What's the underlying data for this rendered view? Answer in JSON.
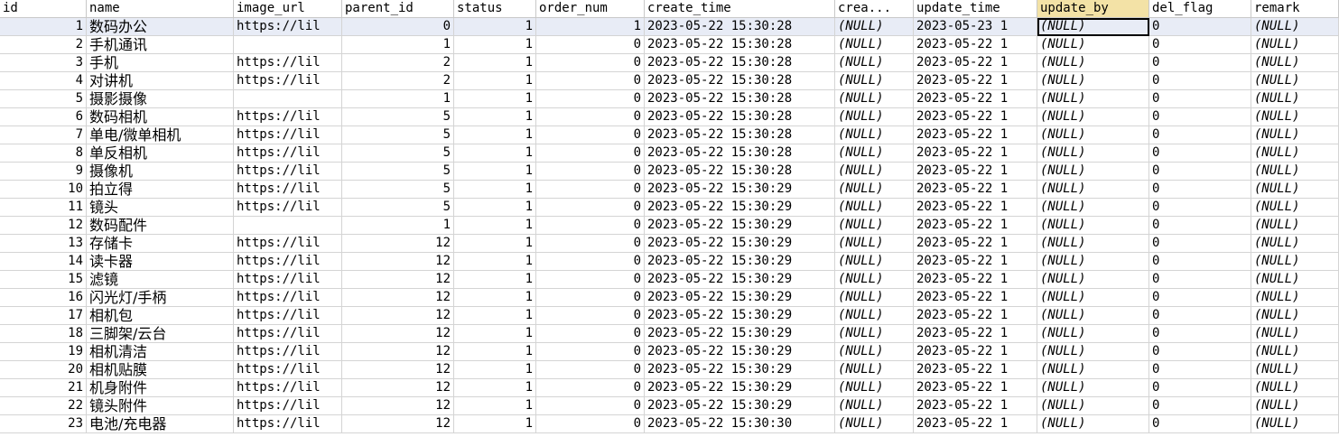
{
  "columns": [
    "id",
    "name",
    "image_url",
    "parent_id",
    "status",
    "order_num",
    "create_time",
    "crea...",
    "update_time",
    "update_by",
    "del_flag",
    "remark"
  ],
  "rows": [
    {
      "id": "1",
      "name": "数码办公",
      "image_url": "https://lil",
      "parent_id": "0",
      "status": "1",
      "order_num": "1",
      "create_time": "2023-05-22 15:30:28",
      "create_by": "(NULL)",
      "update_time": "2023-05-23 1",
      "update_by": "(NULL)",
      "del_flag": "0",
      "remark": "(NULL)"
    },
    {
      "id": "2",
      "name": "手机通讯",
      "image_url": "",
      "parent_id": "1",
      "status": "1",
      "order_num": "0",
      "create_time": "2023-05-22 15:30:28",
      "create_by": "(NULL)",
      "update_time": "2023-05-22 1",
      "update_by": "(NULL)",
      "del_flag": "0",
      "remark": "(NULL)"
    },
    {
      "id": "3",
      "name": "手机",
      "image_url": "https://lil",
      "parent_id": "2",
      "status": "1",
      "order_num": "0",
      "create_time": "2023-05-22 15:30:28",
      "create_by": "(NULL)",
      "update_time": "2023-05-22 1",
      "update_by": "(NULL)",
      "del_flag": "0",
      "remark": "(NULL)"
    },
    {
      "id": "4",
      "name": "对讲机",
      "image_url": "https://lil",
      "parent_id": "2",
      "status": "1",
      "order_num": "0",
      "create_time": "2023-05-22 15:30:28",
      "create_by": "(NULL)",
      "update_time": "2023-05-22 1",
      "update_by": "(NULL)",
      "del_flag": "0",
      "remark": "(NULL)"
    },
    {
      "id": "5",
      "name": "摄影摄像",
      "image_url": "",
      "parent_id": "1",
      "status": "1",
      "order_num": "0",
      "create_time": "2023-05-22 15:30:28",
      "create_by": "(NULL)",
      "update_time": "2023-05-22 1",
      "update_by": "(NULL)",
      "del_flag": "0",
      "remark": "(NULL)"
    },
    {
      "id": "6",
      "name": "数码相机",
      "image_url": "https://lil",
      "parent_id": "5",
      "status": "1",
      "order_num": "0",
      "create_time": "2023-05-22 15:30:28",
      "create_by": "(NULL)",
      "update_time": "2023-05-22 1",
      "update_by": "(NULL)",
      "del_flag": "0",
      "remark": "(NULL)"
    },
    {
      "id": "7",
      "name": "单电/微单相机",
      "image_url": "https://lil",
      "parent_id": "5",
      "status": "1",
      "order_num": "0",
      "create_time": "2023-05-22 15:30:28",
      "create_by": "(NULL)",
      "update_time": "2023-05-22 1",
      "update_by": "(NULL)",
      "del_flag": "0",
      "remark": "(NULL)"
    },
    {
      "id": "8",
      "name": "单反相机",
      "image_url": "https://lil",
      "parent_id": "5",
      "status": "1",
      "order_num": "0",
      "create_time": "2023-05-22 15:30:28",
      "create_by": "(NULL)",
      "update_time": "2023-05-22 1",
      "update_by": "(NULL)",
      "del_flag": "0",
      "remark": "(NULL)"
    },
    {
      "id": "9",
      "name": "摄像机",
      "image_url": "https://lil",
      "parent_id": "5",
      "status": "1",
      "order_num": "0",
      "create_time": "2023-05-22 15:30:28",
      "create_by": "(NULL)",
      "update_time": "2023-05-22 1",
      "update_by": "(NULL)",
      "del_flag": "0",
      "remark": "(NULL)"
    },
    {
      "id": "10",
      "name": "拍立得",
      "image_url": "https://lil",
      "parent_id": "5",
      "status": "1",
      "order_num": "0",
      "create_time": "2023-05-22 15:30:29",
      "create_by": "(NULL)",
      "update_time": "2023-05-22 1",
      "update_by": "(NULL)",
      "del_flag": "0",
      "remark": "(NULL)"
    },
    {
      "id": "11",
      "name": "镜头",
      "image_url": "https://lil",
      "parent_id": "5",
      "status": "1",
      "order_num": "0",
      "create_time": "2023-05-22 15:30:29",
      "create_by": "(NULL)",
      "update_time": "2023-05-22 1",
      "update_by": "(NULL)",
      "del_flag": "0",
      "remark": "(NULL)"
    },
    {
      "id": "12",
      "name": "数码配件",
      "image_url": "",
      "parent_id": "1",
      "status": "1",
      "order_num": "0",
      "create_time": "2023-05-22 15:30:29",
      "create_by": "(NULL)",
      "update_time": "2023-05-22 1",
      "update_by": "(NULL)",
      "del_flag": "0",
      "remark": "(NULL)"
    },
    {
      "id": "13",
      "name": "存储卡",
      "image_url": "https://lil",
      "parent_id": "12",
      "status": "1",
      "order_num": "0",
      "create_time": "2023-05-22 15:30:29",
      "create_by": "(NULL)",
      "update_time": "2023-05-22 1",
      "update_by": "(NULL)",
      "del_flag": "0",
      "remark": "(NULL)"
    },
    {
      "id": "14",
      "name": "读卡器",
      "image_url": "https://lil",
      "parent_id": "12",
      "status": "1",
      "order_num": "0",
      "create_time": "2023-05-22 15:30:29",
      "create_by": "(NULL)",
      "update_time": "2023-05-22 1",
      "update_by": "(NULL)",
      "del_flag": "0",
      "remark": "(NULL)"
    },
    {
      "id": "15",
      "name": "滤镜",
      "image_url": "https://lil",
      "parent_id": "12",
      "status": "1",
      "order_num": "0",
      "create_time": "2023-05-22 15:30:29",
      "create_by": "(NULL)",
      "update_time": "2023-05-22 1",
      "update_by": "(NULL)",
      "del_flag": "0",
      "remark": "(NULL)"
    },
    {
      "id": "16",
      "name": "闪光灯/手柄",
      "image_url": "https://lil",
      "parent_id": "12",
      "status": "1",
      "order_num": "0",
      "create_time": "2023-05-22 15:30:29",
      "create_by": "(NULL)",
      "update_time": "2023-05-22 1",
      "update_by": "(NULL)",
      "del_flag": "0",
      "remark": "(NULL)"
    },
    {
      "id": "17",
      "name": "相机包",
      "image_url": "https://lil",
      "parent_id": "12",
      "status": "1",
      "order_num": "0",
      "create_time": "2023-05-22 15:30:29",
      "create_by": "(NULL)",
      "update_time": "2023-05-22 1",
      "update_by": "(NULL)",
      "del_flag": "0",
      "remark": "(NULL)"
    },
    {
      "id": "18",
      "name": "三脚架/云台",
      "image_url": "https://lil",
      "parent_id": "12",
      "status": "1",
      "order_num": "0",
      "create_time": "2023-05-22 15:30:29",
      "create_by": "(NULL)",
      "update_time": "2023-05-22 1",
      "update_by": "(NULL)",
      "del_flag": "0",
      "remark": "(NULL)"
    },
    {
      "id": "19",
      "name": "相机清洁",
      "image_url": "https://lil",
      "parent_id": "12",
      "status": "1",
      "order_num": "0",
      "create_time": "2023-05-22 15:30:29",
      "create_by": "(NULL)",
      "update_time": "2023-05-22 1",
      "update_by": "(NULL)",
      "del_flag": "0",
      "remark": "(NULL)"
    },
    {
      "id": "20",
      "name": "相机贴膜",
      "image_url": "https://lil",
      "parent_id": "12",
      "status": "1",
      "order_num": "0",
      "create_time": "2023-05-22 15:30:29",
      "create_by": "(NULL)",
      "update_time": "2023-05-22 1",
      "update_by": "(NULL)",
      "del_flag": "0",
      "remark": "(NULL)"
    },
    {
      "id": "21",
      "name": "机身附件",
      "image_url": "https://lil",
      "parent_id": "12",
      "status": "1",
      "order_num": "0",
      "create_time": "2023-05-22 15:30:29",
      "create_by": "(NULL)",
      "update_time": "2023-05-22 1",
      "update_by": "(NULL)",
      "del_flag": "0",
      "remark": "(NULL)"
    },
    {
      "id": "22",
      "name": "镜头附件",
      "image_url": "https://lil",
      "parent_id": "12",
      "status": "1",
      "order_num": "0",
      "create_time": "2023-05-22 15:30:29",
      "create_by": "(NULL)",
      "update_time": "2023-05-22 1",
      "update_by": "(NULL)",
      "del_flag": "0",
      "remark": "(NULL)"
    },
    {
      "id": "23",
      "name": "电池/充电器",
      "image_url": "https://lil",
      "parent_id": "12",
      "status": "1",
      "order_num": "0",
      "create_time": "2023-05-22 15:30:30",
      "create_by": "(NULL)",
      "update_time": "2023-05-22 1",
      "update_by": "(NULL)",
      "del_flag": "0",
      "remark": "(NULL)"
    }
  ],
  "selection": {
    "row_index": 0,
    "column_key": "update_by"
  },
  "colors": {
    "header_selected": "#f3e2a6",
    "row_selected": "#e8ecf6",
    "grid_line": "#d4d4d4"
  }
}
